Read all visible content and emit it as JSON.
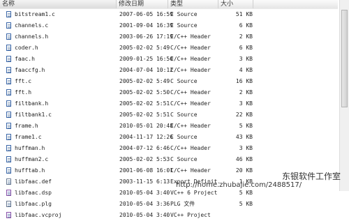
{
  "headers": {
    "name": "名称",
    "date": "修改日期",
    "type": "类型",
    "size": "大小"
  },
  "files": [
    {
      "name": "bitstream1.c",
      "date": "2007-06-05 16:59",
      "type": "C Source",
      "size": "51 KB",
      "icon": "c-source-icon"
    },
    {
      "name": "channels.c",
      "date": "2001-09-04 16:39",
      "type": "C Source",
      "size": "6 KB",
      "icon": "c-source-icon"
    },
    {
      "name": "channels.h",
      "date": "2003-06-26 17:19",
      "type": "C/C++ Header",
      "size": "2 KB",
      "icon": "header-icon"
    },
    {
      "name": "coder.h",
      "date": "2005-02-02 5:49",
      "type": "C/C++ Header",
      "size": "6 KB",
      "icon": "header-icon"
    },
    {
      "name": "faac.h",
      "date": "2009-01-25 16:50",
      "type": "C/C++ Header",
      "size": "3 KB",
      "icon": "header-icon"
    },
    {
      "name": "faaccfg.h",
      "date": "2004-07-04 10:12",
      "type": "C/C++ Header",
      "size": "4 KB",
      "icon": "header-icon"
    },
    {
      "name": "fft.c",
      "date": "2005-02-02 5:49",
      "type": "C Source",
      "size": "16 KB",
      "icon": "c-source-icon"
    },
    {
      "name": "fft.h",
      "date": "2005-02-02 5:50",
      "type": "C/C++ Header",
      "size": "2 KB",
      "icon": "header-icon"
    },
    {
      "name": "filtbank.h",
      "date": "2005-02-02 5:51",
      "type": "C/C++ Header",
      "size": "3 KB",
      "icon": "header-icon"
    },
    {
      "name": "filtbank1.c",
      "date": "2005-02-02 5:51",
      "type": "C Source",
      "size": "22 KB",
      "icon": "c-source-icon"
    },
    {
      "name": "frame.h",
      "date": "2010-05-01 20:48",
      "type": "C/C++ Header",
      "size": "5 KB",
      "icon": "header-icon"
    },
    {
      "name": "frame1.c",
      "date": "2004-11-17 12:26",
      "type": "C Source",
      "size": "43 KB",
      "icon": "c-source-icon"
    },
    {
      "name": "huffman.h",
      "date": "2004-07-12 6:46",
      "type": "C/C++ Header",
      "size": "3 KB",
      "icon": "header-icon"
    },
    {
      "name": "huffman2.c",
      "date": "2005-02-02 5:53",
      "type": "C Source",
      "size": "46 KB",
      "icon": "c-source-icon"
    },
    {
      "name": "hufftab.h",
      "date": "2001-06-08 16:01",
      "type": "C/C++ Header",
      "size": "20 KB",
      "icon": "header-icon"
    },
    {
      "name": "libfaac.def",
      "date": "2003-11-15 6:13",
      "type": "Export Definit...",
      "size": "1 KB",
      "icon": "def-file-icon"
    },
    {
      "name": "libfaac.dsp",
      "date": "2010-05-04 3:40",
      "type": "VC++ 6 Project",
      "size": "5 KB",
      "icon": "project-icon"
    },
    {
      "name": "libfaac.plg",
      "date": "2010-05-04 3:36",
      "type": "PLG 文件",
      "size": "5 KB",
      "icon": "plg-file-icon"
    },
    {
      "name": "libfaac.vcproj",
      "date": "2010-05-04 3:40",
      "type": "VC++ Project",
      "size": "",
      "icon": "vcproj-icon"
    }
  ],
  "watermark": {
    "title": "东银软件工作室",
    "url": "http://home.zhubajie.com/2488517/"
  },
  "colors": {
    "header_bg": "#ececec",
    "text": "#222222",
    "icon_border": "#6a7a92"
  }
}
